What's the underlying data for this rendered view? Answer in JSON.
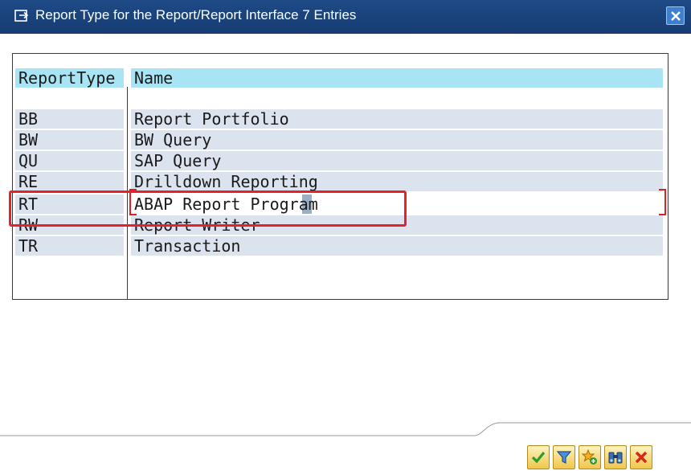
{
  "window": {
    "title": "Report Type for the Report/Report Interface 7 Entries",
    "title_icon": "dialog-arrow-icon",
    "close_icon": "close-icon"
  },
  "table": {
    "columns": [
      "ReportType",
      "Name"
    ],
    "rows": [
      {
        "type": "BB",
        "name": "Report Portfolio"
      },
      {
        "type": "BW",
        "name": "BW Query"
      },
      {
        "type": "QU",
        "name": "SAP Query"
      },
      {
        "type": "RE",
        "name": "Drilldown Reporting"
      },
      {
        "type": "RT",
        "name": "ABAP Report Program"
      },
      {
        "type": "RW",
        "name": "Report Writer"
      },
      {
        "type": "TR",
        "name": "Transaction"
      }
    ],
    "selected_row_type": "RT"
  },
  "footer": {
    "buttons": [
      {
        "icon": "checkmark-icon",
        "name": "continue-button"
      },
      {
        "icon": "filter-icon",
        "name": "filter-button"
      },
      {
        "icon": "new-favorite-icon",
        "name": "add-favorite-button"
      },
      {
        "icon": "binoculars-icon",
        "name": "find-button"
      },
      {
        "icon": "cancel-icon",
        "name": "cancel-button"
      }
    ]
  },
  "colors": {
    "titlebar": "#1e4a86",
    "header_row": "#a8e4f4",
    "data_row": "#dbe3ee",
    "annotation": "#e8202a",
    "button": "#f0c64a"
  }
}
